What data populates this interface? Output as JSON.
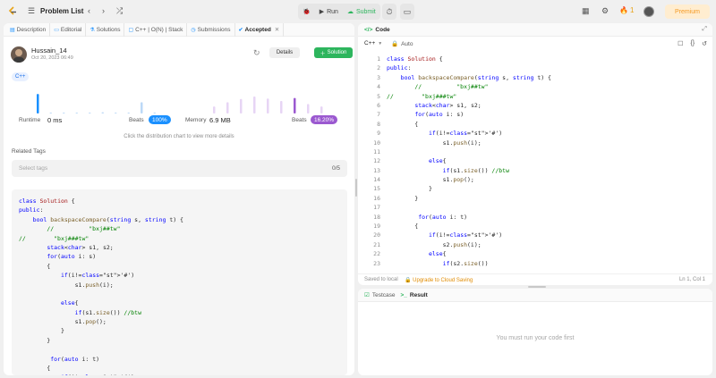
{
  "topbar": {
    "problem_list": "Problem List",
    "run_label": "Run",
    "submit_label": "Submit",
    "streak_count": "1",
    "premium_label": "Premium"
  },
  "left_tabs": [
    {
      "label": "Description"
    },
    {
      "label": "Editorial"
    },
    {
      "label": "Solutions"
    },
    {
      "label": "C++ | O(N) | Stack"
    },
    {
      "label": "Submissions"
    },
    {
      "label": "Accepted"
    }
  ],
  "submission": {
    "user": "Hussain_14",
    "date": "Oct 20, 2023 06:49",
    "details_label": "Details",
    "solution_label": "Solution",
    "language": "C++",
    "runtime_label": "Runtime",
    "runtime_value": "0 ms",
    "runtime_beats_label": "Beats",
    "runtime_beats_value": "100%",
    "memory_label": "Memory",
    "memory_value": "6.9 MB",
    "memory_beats_label": "Beats",
    "memory_beats_value": "16.20%",
    "hint": "Click the distribution chart to view more details",
    "related_tags_label": "Related Tags",
    "tags_placeholder": "Select tags",
    "tags_count": "0/5"
  },
  "colors": {
    "runtime_bar": "#1a90ff",
    "runtime_bar_light": "#bcd9f7",
    "memory_bar": "#9b59d0",
    "memory_bar_light": "#e7d5f5",
    "green": "#2db55d",
    "premium": "#f59a23"
  },
  "runtime_bars": [
    0.78,
    0,
    0,
    0,
    0,
    0.05,
    0,
    0,
    0.45,
    0.04
  ],
  "memory_bars": [
    0.28,
    0.45,
    0.58,
    0.68,
    0.6,
    0.5,
    0.62,
    0.38,
    0.28
  ],
  "memory_active_index": 6,
  "code_panel": {
    "title": "Code",
    "language": "C++",
    "auto_label": "Auto",
    "saved_text": "Saved to local",
    "cloud_text": "Upgrade to Cloud Saving",
    "cursor_pos": "Ln 1, Col 1"
  },
  "bottom_panel": {
    "testcase_label": "Testcase",
    "result_label": "Result",
    "message": "You must run your code first"
  },
  "code_lines": [
    "class Solution {",
    "public:",
    "    bool backspaceCompare(string s, string t) {",
    "        //          \"bxj##tw\"",
    "//        \"bxj###tw\"",
    "        stack<char> s1, s2;",
    "        for(auto i: s)",
    "        {",
    "            if(i!='#')",
    "                s1.push(i);",
    "",
    "            else{",
    "                if(s1.size()) //btw",
    "                s1.pop();",
    "            }",
    "        }",
    "",
    "         for(auto i: t)",
    "        {",
    "            if(i!='#')",
    "                s2.push(i);",
    "            else{",
    "                if(s2.size())"
  ],
  "line_numbers": [
    "1",
    "2",
    "3",
    "4",
    "5",
    "6",
    "7",
    "8",
    "9",
    "10",
    "11",
    "12",
    "13",
    "14",
    "15",
    "16",
    "17",
    "18",
    "19",
    "20",
    "21",
    "22",
    "23"
  ],
  "preview_lines": [
    "class Solution {",
    "public:",
    "    bool backspaceCompare(string s, string t) {",
    "        //          \"bxj##tw\"",
    "//        \"bxj###tw\"",
    "        stack<char> s1, s2;",
    "        for(auto i: s)",
    "        {",
    "            if(i!='#')",
    "                s1.push(i);",
    "",
    "            else{",
    "                if(s1.size()) //btw",
    "                s1.pop();",
    "            }",
    "        }",
    "",
    "         for(auto i: t)",
    "        {",
    "            if(i!='#')"
  ]
}
